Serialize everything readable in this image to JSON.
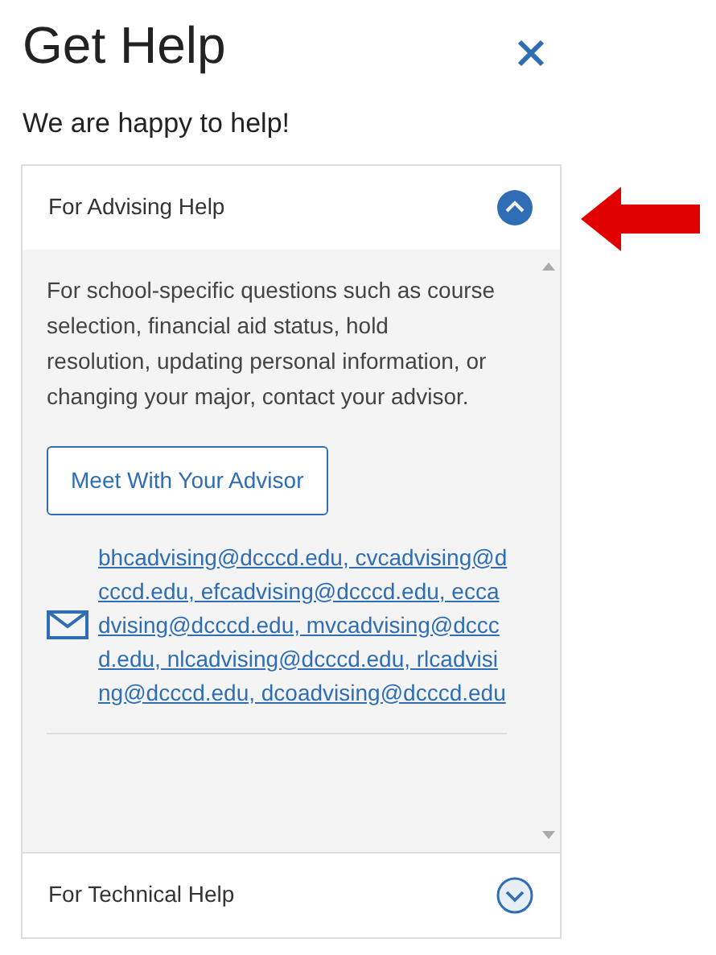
{
  "title": "Get Help",
  "subtitle": "We are happy to help!",
  "sections": [
    {
      "title": "For Advising Help",
      "expanded": true,
      "body": "For school-specific questions such as course selection, financial aid status, hold resolution, updating personal information, or changing your major, contact your advisor.",
      "button": "Meet With Your Advisor",
      "email": "bhcadvising@dcccd.edu, cvcadvising@dcccd.edu, efcadvising@dcccd.edu, eccadvising@dcccd.edu, mvcadvising@dcccd.edu, nlcadvising@dcccd.edu, rlcadvising@dcccd.edu, dcoadvising@dcccd.edu"
    },
    {
      "title": "For Technical Help",
      "expanded": false
    }
  ]
}
